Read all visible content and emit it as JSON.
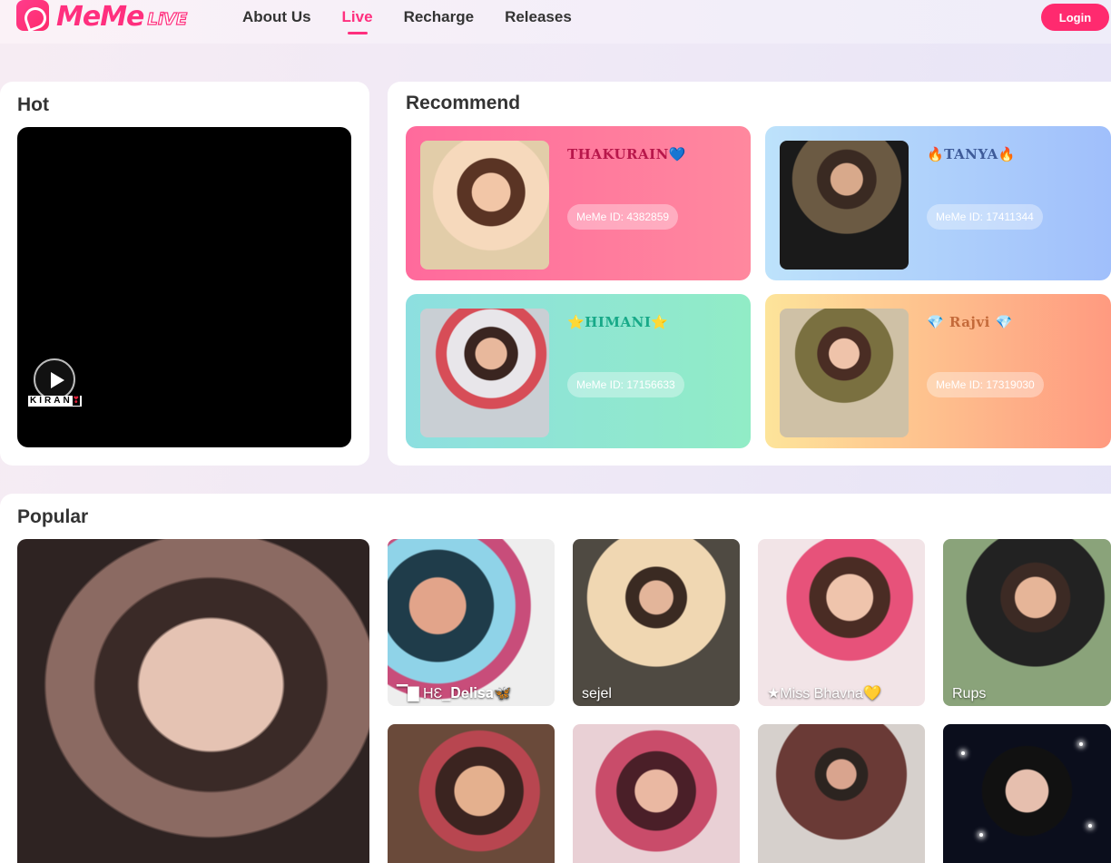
{
  "header": {
    "logo_text": "MeMe",
    "logo_sub": "LiVE",
    "nav": [
      "About Us",
      "Live",
      "Recharge",
      "Releases"
    ],
    "active_nav": "Live",
    "login_label": "Login"
  },
  "hot": {
    "title": "Hot",
    "streamer_name": "KIRAN",
    "heart": "❣"
  },
  "recommend": {
    "title": "Recommend",
    "items": [
      {
        "name": "THAKURAIN💙",
        "id": "MeMe ID: 4382859"
      },
      {
        "name": "🔥TANYA🔥",
        "id": "MeMe ID: 17411344"
      },
      {
        "name": "⭐HIMANI⭐",
        "id": "MeMe ID: 17156633"
      },
      {
        "name": "💎 Rajvi 💎",
        "id": "MeMe ID: 17319030"
      }
    ]
  },
  "popular": {
    "title": "Popular",
    "tiles": [
      {
        "label": "▔▇ HƐ_𝐃𝐞𝐥𝐢𝐬𝐚🦋"
      },
      {
        "label": "sejel"
      },
      {
        "label": "★Miss Bhavna💛"
      },
      {
        "label": "Rups"
      },
      {
        "label": ""
      },
      {
        "label": ""
      },
      {
        "label": ""
      },
      {
        "label": ""
      }
    ]
  },
  "colors": {
    "brand": "#ff2f7e",
    "login_bg": "#ff2a6f"
  },
  "icons": [
    "logo-mark-icon",
    "play-icon"
  ]
}
